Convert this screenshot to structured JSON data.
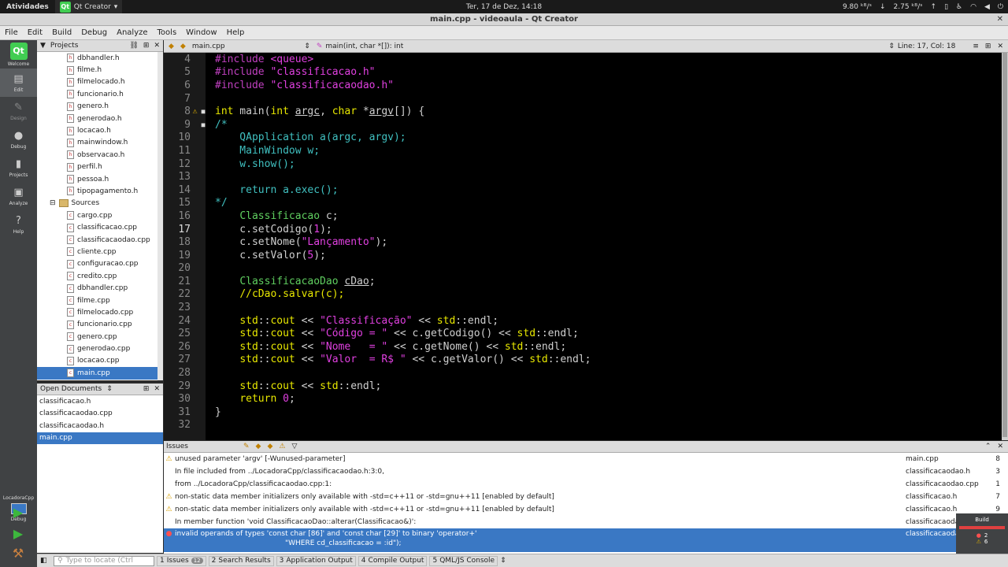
{
  "system": {
    "activities": "Atividades",
    "app_name": "Qt Creator",
    "clock": "Ter, 17 de Dez, 14:18",
    "net_down": "9.80 ᵏᴮ/ˢ",
    "net_up": "2.75 ᵏᴮ/ˢ"
  },
  "window": {
    "title": "main.cpp - videoaula - Qt Creator"
  },
  "menu": [
    "File",
    "Edit",
    "Build",
    "Debug",
    "Analyze",
    "Tools",
    "Window",
    "Help"
  ],
  "modes": [
    {
      "label": "Welcome",
      "icon": "qt-logo-icon"
    },
    {
      "label": "Edit",
      "icon": "edit-icon"
    },
    {
      "label": "Design",
      "icon": "design-icon"
    },
    {
      "label": "Debug",
      "icon": "debug-icon"
    },
    {
      "label": "Projects",
      "icon": "projects-icon"
    },
    {
      "label": "Analyze",
      "icon": "analyze-icon"
    },
    {
      "label": "Help",
      "icon": "help-icon"
    }
  ],
  "kit": {
    "project": "LocadoraCpp",
    "mode": "Debug"
  },
  "projects_pane": {
    "title": "Projects",
    "headers": [
      "dbhandler.h",
      "filme.h",
      "filmelocado.h",
      "funcionario.h",
      "genero.h",
      "generodao.h",
      "locacao.h",
      "mainwindow.h",
      "observacao.h",
      "perfil.h",
      "pessoa.h",
      "tipopagamento.h"
    ],
    "sources_label": "Sources",
    "sources": [
      "cargo.cpp",
      "classificacao.cpp",
      "classificacaodao.cpp",
      "cliente.cpp",
      "configuracao.cpp",
      "credito.cpp",
      "dbhandler.cpp",
      "filme.cpp",
      "filmelocado.cpp",
      "funcionario.cpp",
      "genero.cpp",
      "generodao.cpp",
      "locacao.cpp",
      "main.cpp"
    ],
    "selected": "main.cpp"
  },
  "open_documents": {
    "title": "Open Documents",
    "items": [
      "classificacao.h",
      "classificacaodao.cpp",
      "classificacaodao.h",
      "main.cpp"
    ],
    "selected": "main.cpp"
  },
  "editor": {
    "file": "main.cpp",
    "symbol": "main(int, char *[]): int",
    "position": "Line: 17, Col: 18"
  },
  "issues": {
    "title": "Issues",
    "rows": [
      {
        "type": "warning",
        "message": "unused parameter 'argv' [-Wunused-parameter]",
        "file": "main.cpp",
        "line": "8"
      },
      {
        "type": "none",
        "message": "In file included from ../LocadoraCpp/classificacaodao.h:3:0,",
        "file": "classificacaodao.h",
        "line": "3"
      },
      {
        "type": "none",
        "message": "from ../LocadoraCpp/classificacaodao.cpp:1:",
        "file": "classificacaodao.cpp",
        "line": "1"
      },
      {
        "type": "warning",
        "message": "non-static data member initializers only available with -std=c++11 or -std=gnu++11 [enabled by default]",
        "file": "classificacao.h",
        "line": "7"
      },
      {
        "type": "warning",
        "message": "non-static data member initializers only available with -std=c++11 or -std=gnu++11 [enabled by default]",
        "file": "classificacao.h",
        "line": "9"
      },
      {
        "type": "none",
        "message": "In member function 'void ClassificacaoDao::alterar(Classificacao&)':",
        "file": "classificacaoda",
        "line": ""
      },
      {
        "type": "error",
        "message": "invalid operands of types 'const char [86]' and 'const char [29]' to binary 'operator+'",
        "message2": "\"WHERE cd_classificacao = :id\");",
        "file": "classificacaoda",
        "line": ""
      }
    ]
  },
  "statusbar": {
    "locator_placeholder": "Type to locate (Ctrl",
    "tabs": [
      {
        "num": "1",
        "label": "Issues",
        "badge": "12"
      },
      {
        "num": "2",
        "label": "Search Results"
      },
      {
        "num": "3",
        "label": "Application Output"
      },
      {
        "num": "4",
        "label": "Compile Output"
      },
      {
        "num": "5",
        "label": "QML/JS Console"
      }
    ]
  },
  "build_popup": {
    "label": "Build",
    "errors": "2",
    "warnings": "6"
  }
}
